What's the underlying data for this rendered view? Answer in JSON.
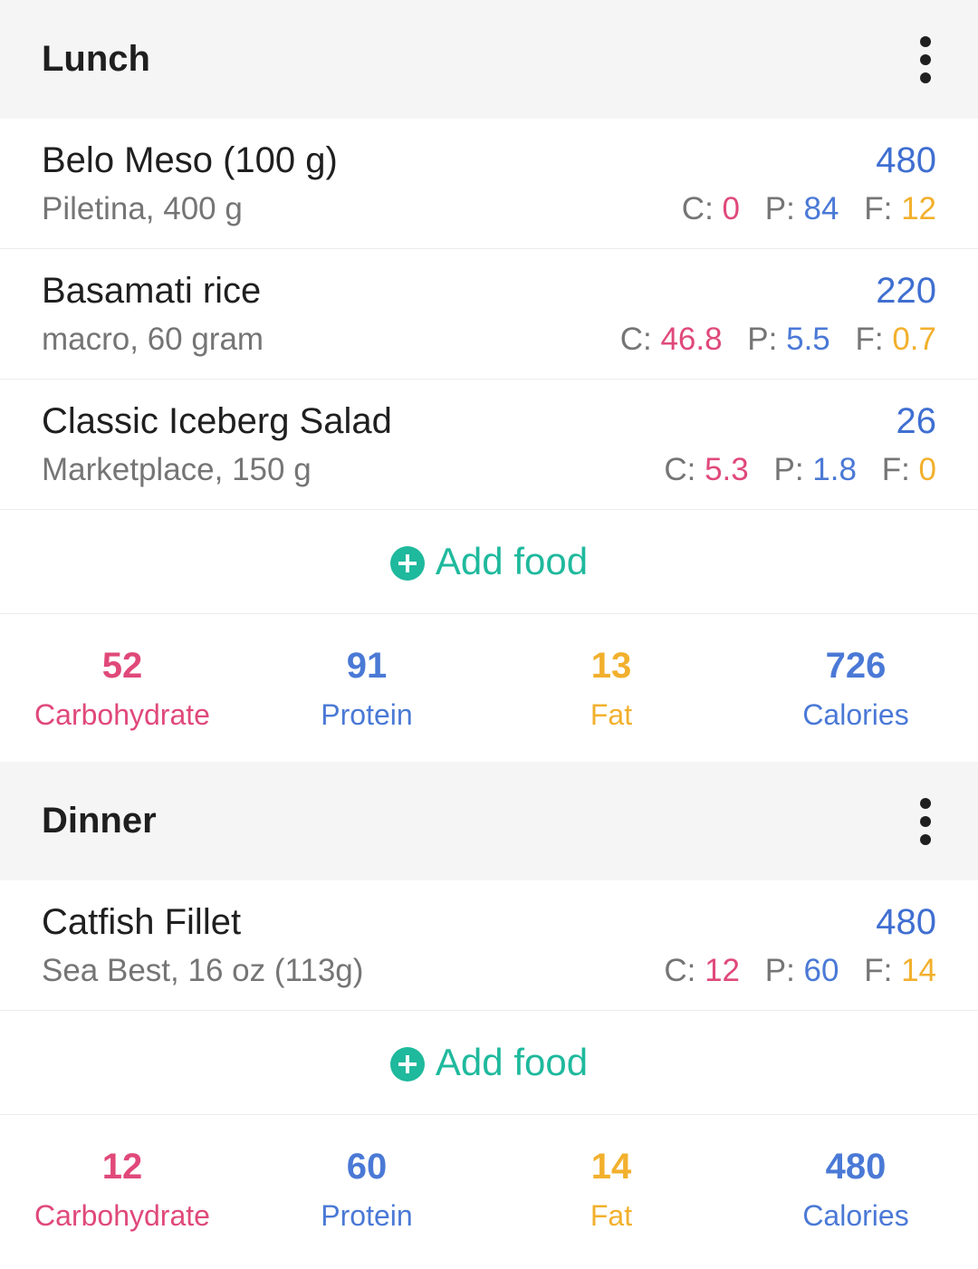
{
  "colors": {
    "carb": "#e0497a",
    "protein": "#4a79d6",
    "fat": "#f2b02d",
    "calories": "#3f6fd1",
    "accent": "#1fb99d"
  },
  "icons": {
    "more": "more-vertical-icon",
    "add": "plus-circle-icon"
  },
  "lunch": {
    "title": "Lunch",
    "items": [
      {
        "name": "Belo Meso (100 g)",
        "sub": "Piletina, 400 g",
        "calories": "480",
        "c_label": "C:",
        "c": "0",
        "p_label": "P:",
        "p": "84",
        "f_label": "F:",
        "f": "12"
      },
      {
        "name": "Basamati rice",
        "sub": "macro, 60 gram",
        "calories": "220",
        "c_label": "C:",
        "c": "46.8",
        "p_label": "P:",
        "p": "5.5",
        "f_label": "F:",
        "f": "0.7"
      },
      {
        "name": "Classic Iceberg Salad",
        "sub": "Marketplace, 150 g",
        "calories": "26",
        "c_label": "C:",
        "c": "5.3",
        "p_label": "P:",
        "p": "1.8",
        "f_label": "F:",
        "f": "0"
      }
    ],
    "add_label": "Add food",
    "totals": {
      "carb": "52",
      "carb_label": "Carbohydrate",
      "protein": "91",
      "protein_label": "Protein",
      "fat": "13",
      "fat_label": "Fat",
      "calories": "726",
      "calories_label": "Calories"
    }
  },
  "dinner": {
    "title": "Dinner",
    "items": [
      {
        "name": "Catfish Fillet",
        "sub": "Sea Best, 16 oz (113g)",
        "calories": "480",
        "c_label": "C:",
        "c": "12",
        "p_label": "P:",
        "p": "60",
        "f_label": "F:",
        "f": "14"
      }
    ],
    "add_label": "Add food",
    "totals": {
      "carb": "12",
      "carb_label": "Carbohydrate",
      "protein": "60",
      "protein_label": "Protein",
      "fat": "14",
      "fat_label": "Fat",
      "calories": "480",
      "calories_label": "Calories"
    }
  }
}
